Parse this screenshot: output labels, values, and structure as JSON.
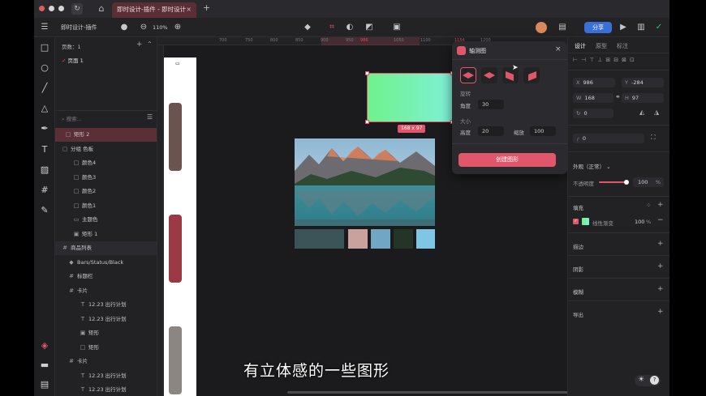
{
  "window": {
    "tab_title": "即时设计-插件 - 即时设计",
    "tab_close": "×",
    "new_tab": "+"
  },
  "toolbar": {
    "file_name": "即时设计-插件",
    "zoom": "110%",
    "share_label": "分享"
  },
  "layers": {
    "pages_label": "页数：1",
    "page_item": "页面 1",
    "search_placeholder": "搜索...",
    "items": [
      {
        "label": "矩形 2",
        "icon": "□",
        "indent": 6,
        "selected": true
      },
      {
        "label": "分组 色板",
        "icon": "▢",
        "indent": 2
      },
      {
        "label": "颜色4",
        "icon": "□",
        "indent": 16
      },
      {
        "label": "颜色3",
        "icon": "□",
        "indent": 16
      },
      {
        "label": "颜色2",
        "icon": "□",
        "indent": 16
      },
      {
        "label": "颜色1",
        "icon": "□",
        "indent": 16
      },
      {
        "label": "主题色",
        "icon": "▭",
        "indent": 16
      },
      {
        "label": "矩形 1",
        "icon": "▣",
        "indent": 16
      },
      {
        "label": "商品列表",
        "icon": "#",
        "indent": 2,
        "highlight": true
      },
      {
        "label": "Bars/Status/Black",
        "icon": "◆",
        "indent": 10
      },
      {
        "label": "标题栏",
        "icon": "#",
        "indent": 10
      },
      {
        "label": "卡片",
        "icon": "#",
        "indent": 10
      },
      {
        "label": "12.23 出行计划",
        "icon": "T",
        "indent": 24
      },
      {
        "label": "12.23 出行计划",
        "icon": "T",
        "indent": 24
      },
      {
        "label": "矩形",
        "icon": "▣",
        "indent": 24
      },
      {
        "label": "矩形",
        "icon": "□",
        "indent": 24
      },
      {
        "label": "卡片",
        "icon": "#",
        "indent": 10
      },
      {
        "label": "12.23 出行计划",
        "icon": "T",
        "indent": 24
      },
      {
        "label": "12.23 出行计划",
        "icon": "T",
        "indent": 24
      }
    ]
  },
  "ruler": {
    "ticks": [
      "700",
      "750",
      "800",
      "850",
      "900",
      "950",
      "986",
      "1050",
      "1100",
      "1154",
      "1200"
    ]
  },
  "canvas": {
    "size_badge": "168 x 97",
    "gradient_from": "#6ff28b",
    "gradient_to": "#7ff0d6",
    "swatches": [
      "#3c5358",
      "#c9a29e",
      "#72a7c4",
      "#243527",
      "#7ec6e3"
    ]
  },
  "iso_dialog": {
    "title": "轴测图",
    "close": "×",
    "rotate_label": "旋转",
    "angle_label": "角度",
    "angle_value": "30",
    "size_label": "大小",
    "height_label": "高度",
    "height_value": "20",
    "scale_label": "缩放",
    "scale_value": "100",
    "create_button": "创建图形"
  },
  "properties": {
    "tabs": [
      "设计",
      "原型",
      "标注"
    ],
    "x_label": "X",
    "x_value": "986",
    "y_label": "Y",
    "y_value": "-284",
    "w_label": "W",
    "w_value": "168",
    "h_label": "H",
    "h_value": "97",
    "rotation_value": "0",
    "radius_value": "0",
    "appearance_label": "外观（正常）",
    "opacity_label": "不透明度",
    "opacity_value": "100",
    "opacity_unit": "%",
    "opacity_level": 1.0,
    "fill_label": "填充",
    "fill_type": "线性渐变",
    "fill_opacity": "100",
    "fill_unit": "%",
    "stroke_label": "描边",
    "shadow_label": "阴影",
    "blur_label": "模糊",
    "export_label": "导出"
  },
  "caption": "有立体感的一些图形"
}
